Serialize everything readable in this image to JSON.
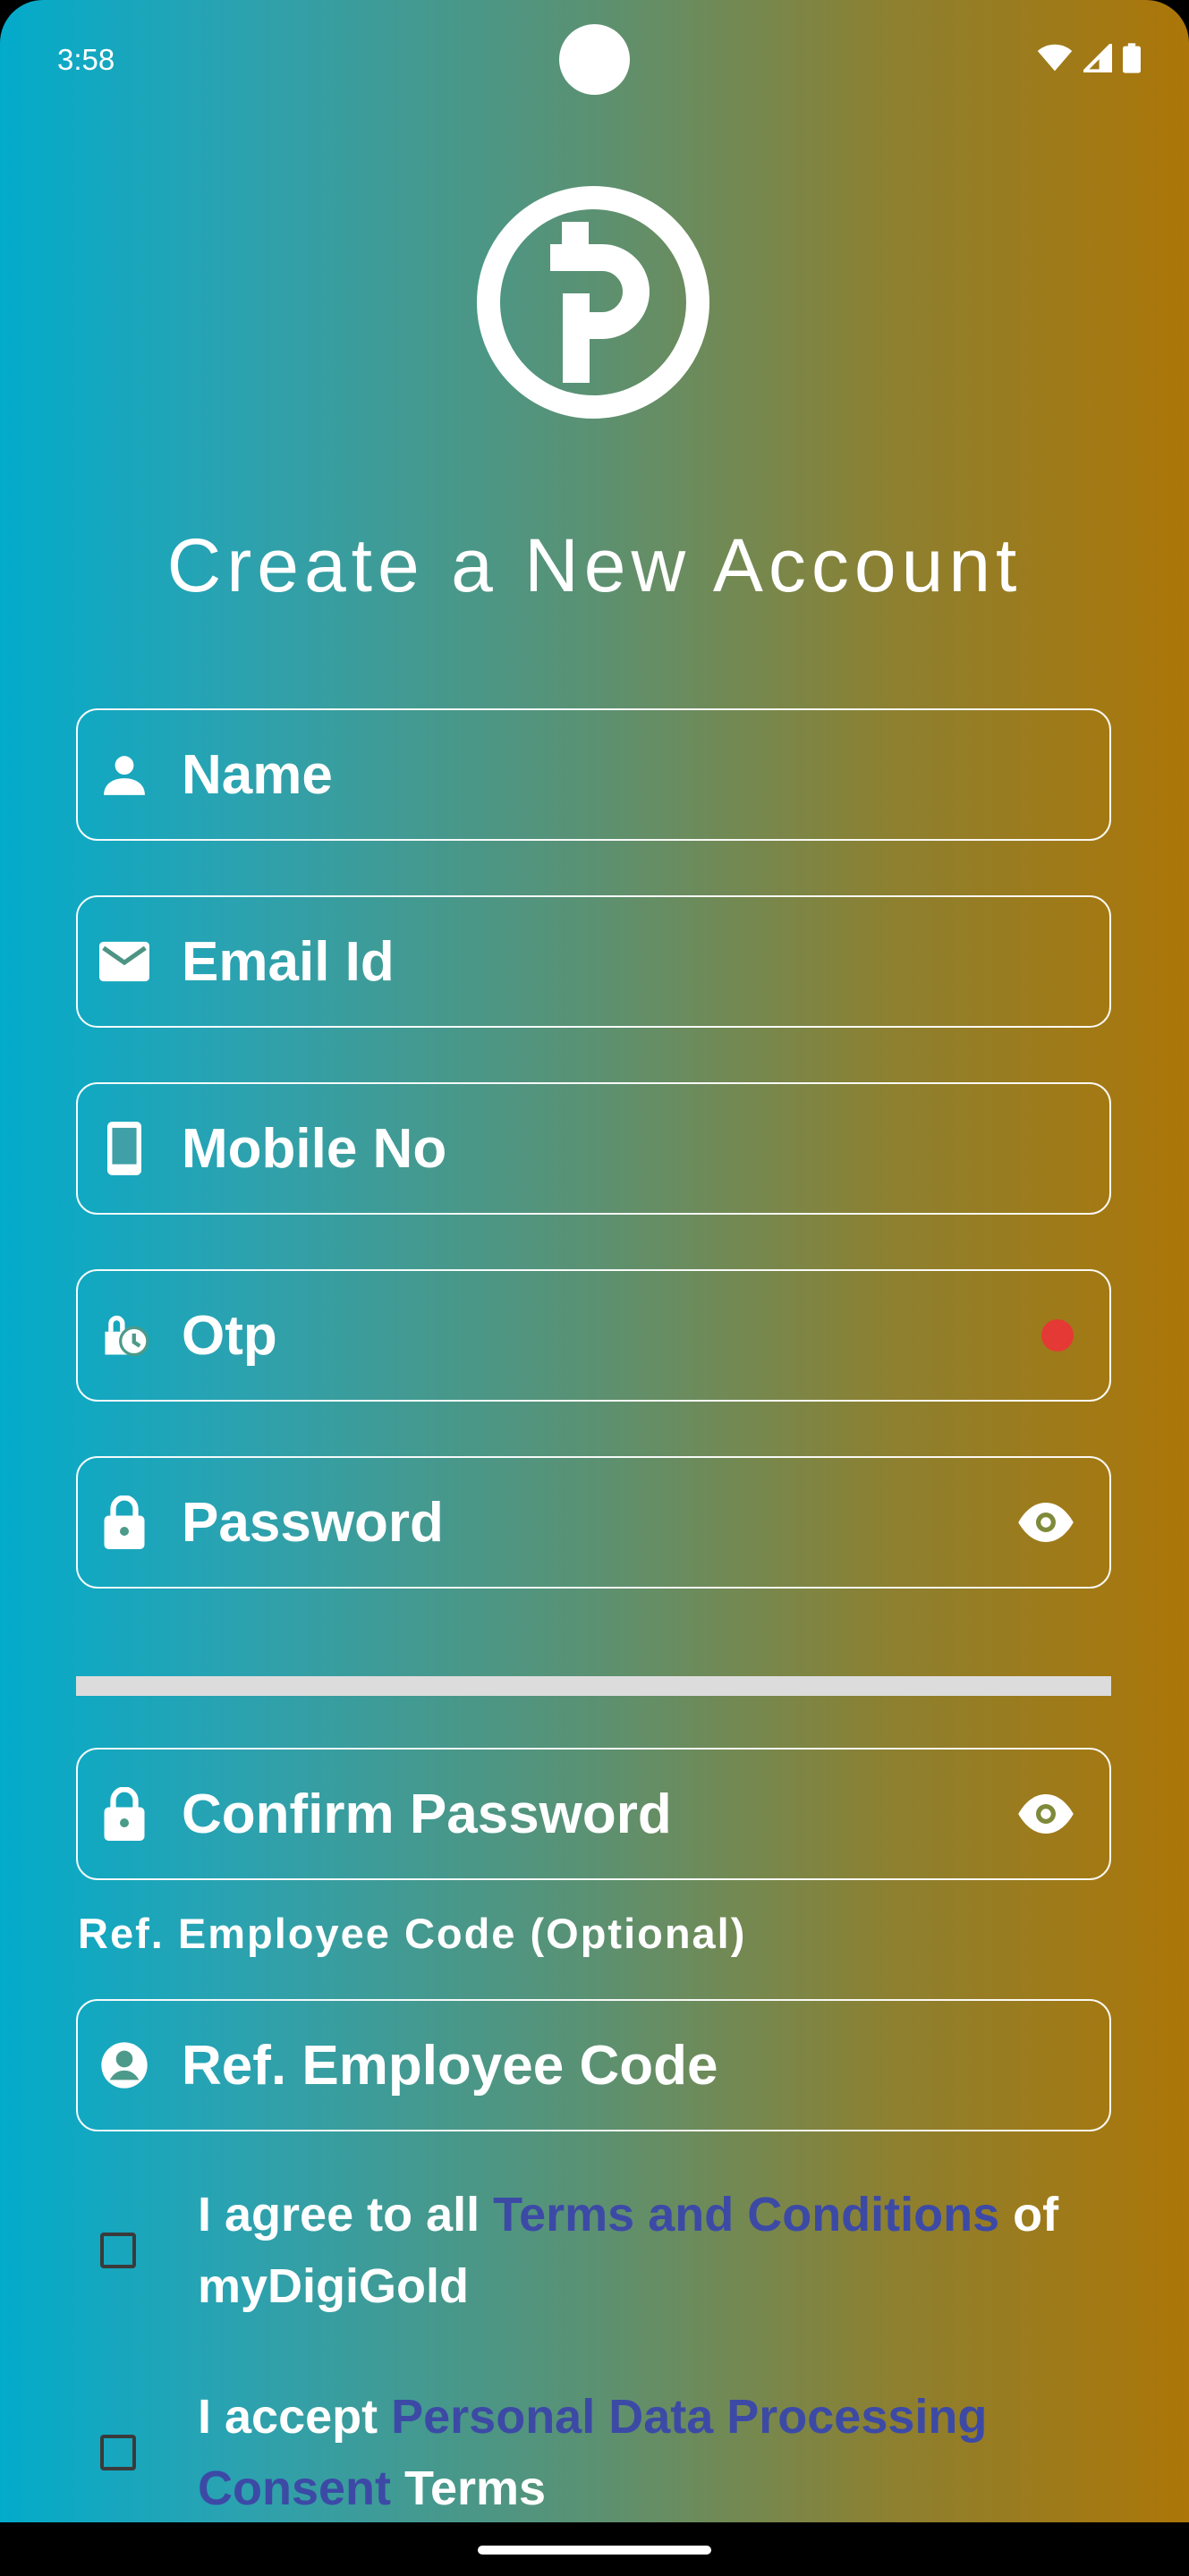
{
  "status_bar": {
    "time": "3:58"
  },
  "title": "Create a New Account",
  "fields": {
    "name": {
      "label": "Name",
      "icon": "person-icon"
    },
    "email": {
      "label": "Email Id",
      "icon": "mail-icon"
    },
    "mobile": {
      "label": "Mobile No",
      "icon": "phone-icon"
    },
    "otp": {
      "label": "Otp",
      "icon": "otp-lock-clock-icon",
      "indicator_color": "#e53935"
    },
    "password": {
      "label": "Password",
      "icon": "lock-icon"
    },
    "confirm_password": {
      "label": "Confirm Password",
      "icon": "lock-icon"
    },
    "ref_employee_code": {
      "label": "Ref. Employee Code",
      "icon": "account-circle-icon"
    }
  },
  "ref_hint": "Ref. Employee Code (Optional)",
  "terms": {
    "prefix": "I agree to all ",
    "link": "Terms and Conditions",
    "suffix": " of myDigiGold"
  },
  "consent": {
    "prefix": "I accept ",
    "link": "Personal Data Processing Consent",
    "suffix": " Terms"
  },
  "colors": {
    "link": "#3c4aa6",
    "gradient_left": "#03abcb",
    "gradient_right": "#ac7608"
  }
}
